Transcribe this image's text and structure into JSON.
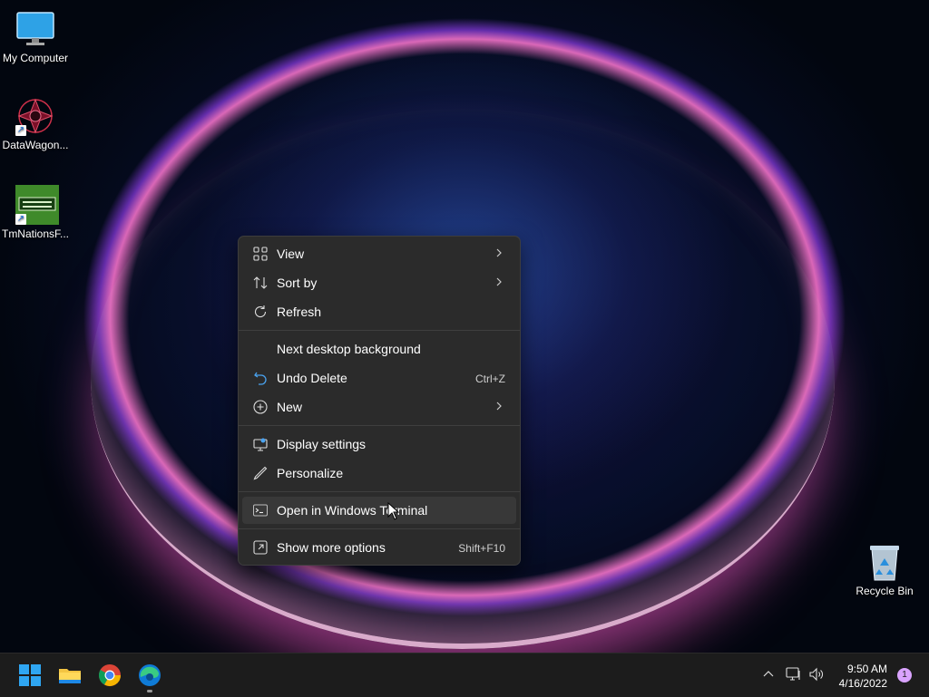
{
  "desktop": {
    "icons": [
      {
        "label": "My Computer",
        "icon": "monitor-icon"
      },
      {
        "label": "DataWagon...",
        "icon": "datawagon-app-icon"
      },
      {
        "label": "TmNationsF...",
        "icon": "tmnations-app-icon"
      },
      {
        "label": "Recycle Bin",
        "icon": "recycle-bin-icon"
      }
    ]
  },
  "context_menu": {
    "items": [
      {
        "label": "View",
        "icon": "grid-icon",
        "submenu": true
      },
      {
        "label": "Sort by",
        "icon": "sort-icon",
        "submenu": true
      },
      {
        "label": "Refresh",
        "icon": "refresh-icon"
      },
      {
        "label": "Next desktop background",
        "icon": ""
      },
      {
        "label": "Undo Delete",
        "icon": "undo-icon",
        "shortcut": "Ctrl+Z"
      },
      {
        "label": "New",
        "icon": "plus-circle-icon",
        "submenu": true
      },
      {
        "label": "Display settings",
        "icon": "display-icon"
      },
      {
        "label": "Personalize",
        "icon": "pen-icon"
      },
      {
        "label": "Open in Windows Terminal",
        "icon": "terminal-icon",
        "highlighted": true
      },
      {
        "label": "Show more options",
        "icon": "expand-icon",
        "shortcut": "Shift+F10"
      }
    ]
  },
  "taskbar": {
    "apps": [
      "start-icon",
      "file-explorer-icon",
      "chrome-icon",
      "edge-icon"
    ],
    "tray": [
      "chevron-up-icon",
      "network-icon",
      "volume-icon"
    ],
    "time": "9:50 AM",
    "date": "4/16/2022",
    "notification_count": "1"
  },
  "colors": {
    "menu_bg": "#2b2b2b",
    "menu_hover": "#383838",
    "taskbar_bg": "#1c1c1c",
    "accent": "#0078d4"
  }
}
